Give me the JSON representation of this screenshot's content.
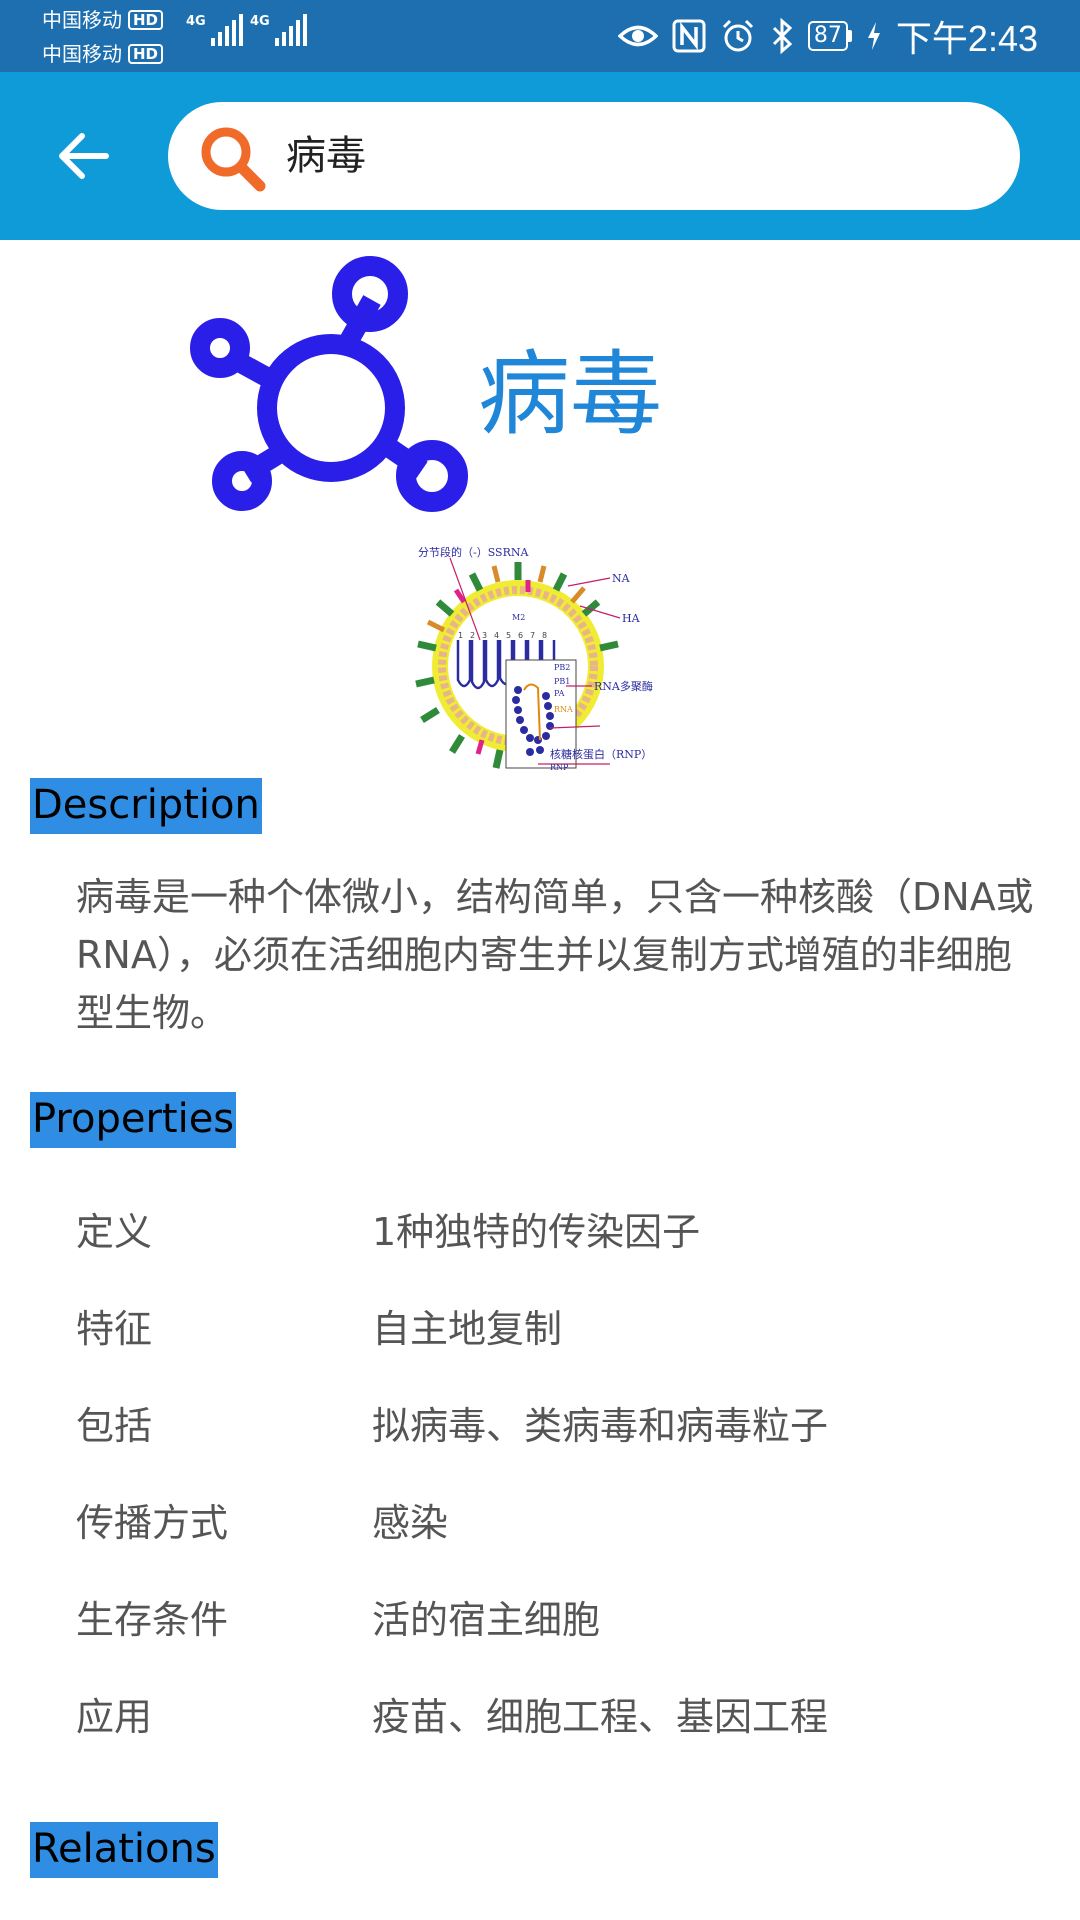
{
  "status_bar": {
    "carrier1": "中国移动",
    "carrier2": "中国移动",
    "hd_badge": "HD",
    "network": "4G",
    "battery": "87",
    "time": "下午2:43"
  },
  "search": {
    "query": "病毒"
  },
  "entity": {
    "title": "病毒"
  },
  "diagram_labels": {
    "top": "分节段的（-）SSRNA",
    "na": "NA",
    "ha": "HA",
    "m2": "M2",
    "pb2": "PB2",
    "pb1": "PB1",
    "pa": "PA",
    "rna": "RNA",
    "polymerase": "RNA多聚酶",
    "rnp": "核糖核蛋白（RNP）",
    "rnp_short": "RNP",
    "segments": [
      "1",
      "2",
      "3",
      "4",
      "5",
      "6",
      "7",
      "8"
    ]
  },
  "sections": {
    "description": "Description",
    "properties": "Properties",
    "relations": "Relations"
  },
  "description_text": "病毒是一种个体微小，结构简单，只含一种核酸（DNA或RNA），必须在活细胞内寄生并以复制方式增殖的非细胞型生物。",
  "properties": [
    {
      "key": "定义",
      "value": "1种独特的传染因子"
    },
    {
      "key": "特征",
      "value": "自主地复制"
    },
    {
      "key": "包括",
      "value": "拟病毒、类病毒和病毒粒子"
    },
    {
      "key": "传播方式",
      "value": "感染"
    },
    {
      "key": "生存条件",
      "value": "活的宿主细胞"
    },
    {
      "key": "应用",
      "value": "疫苗、细胞工程、基因工程"
    }
  ],
  "colors": {
    "status_bar": "#1e6fb0",
    "app_bar": "#0f9ad8",
    "accent_title": "#1f86d8",
    "icon_blue": "#2a1fe8",
    "section_label_bg": "#2f8ee3",
    "search_icon": "#f06a2a"
  },
  "icons": {
    "back": "arrow-left-icon",
    "search": "magnifier-icon",
    "hero": "virus-molecule-icon"
  }
}
